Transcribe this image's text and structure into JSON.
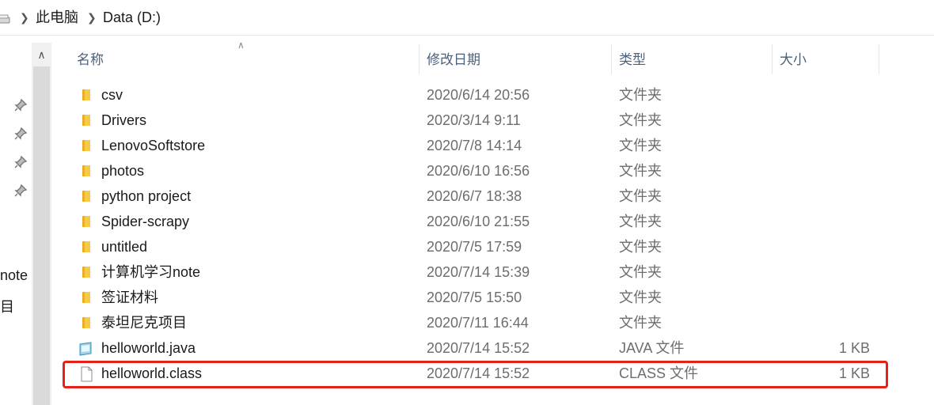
{
  "breadcrumb": {
    "items": [
      "此电脑",
      "Data (D:)"
    ]
  },
  "nav": {
    "partial_items": [
      "note",
      "目"
    ]
  },
  "columns": {
    "name": "名称",
    "date": "修改日期",
    "type": "类型",
    "size": "大小"
  },
  "files": [
    {
      "name": "csv",
      "date": "2020/6/14 20:56",
      "type": "文件夹",
      "size": "",
      "icon": "folder-icon"
    },
    {
      "name": "Drivers",
      "date": "2020/3/14 9:11",
      "type": "文件夹",
      "size": "",
      "icon": "folder-icon"
    },
    {
      "name": "LenovoSoftstore",
      "date": "2020/7/8 14:14",
      "type": "文件夹",
      "size": "",
      "icon": "folder-icon"
    },
    {
      "name": "photos",
      "date": "2020/6/10 16:56",
      "type": "文件夹",
      "size": "",
      "icon": "folder-icon"
    },
    {
      "name": "python project",
      "date": "2020/6/7 18:38",
      "type": "文件夹",
      "size": "",
      "icon": "folder-icon"
    },
    {
      "name": "Spider-scrapy",
      "date": "2020/6/10 21:55",
      "type": "文件夹",
      "size": "",
      "icon": "folder-icon"
    },
    {
      "name": "untitled",
      "date": "2020/7/5 17:59",
      "type": "文件夹",
      "size": "",
      "icon": "folder-icon"
    },
    {
      "name": "计算机学习note",
      "date": "2020/7/14 15:39",
      "type": "文件夹",
      "size": "",
      "icon": "folder-icon"
    },
    {
      "name": "签证材料",
      "date": "2020/7/5 15:50",
      "type": "文件夹",
      "size": "",
      "icon": "folder-icon"
    },
    {
      "name": "泰坦尼克项目",
      "date": "2020/7/11 16:44",
      "type": "文件夹",
      "size": "",
      "icon": "folder-icon"
    },
    {
      "name": "helloworld.java",
      "date": "2020/7/14 15:52",
      "type": "JAVA 文件",
      "size": "1 KB",
      "icon": "java-file-icon"
    },
    {
      "name": "helloworld.class",
      "date": "2020/7/14 15:52",
      "type": "CLASS 文件",
      "size": "1 KB",
      "icon": "blank-file-icon"
    }
  ],
  "highlighted_file": "helloworld.class",
  "colors": {
    "highlight_border": "#e8201a",
    "folder_yellow": "#f7c948",
    "header_text": "#4c607a"
  }
}
